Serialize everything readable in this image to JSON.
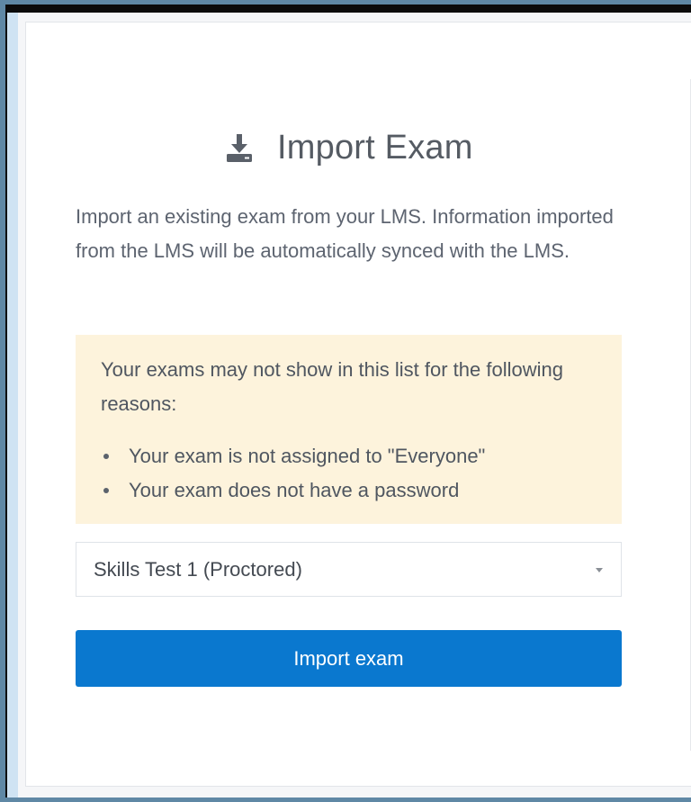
{
  "header": {
    "title": "Import Exam",
    "icon": "download-icon"
  },
  "intro": {
    "text": "Import an existing exam from your LMS. Information imported from the LMS will be automatically synced with the LMS."
  },
  "notice": {
    "lead": "Your exams may not show in this list for the following reasons:",
    "reasons": [
      "Your exam is not assigned to \"Everyone\"",
      "Your exam does not have a password"
    ]
  },
  "exam_select": {
    "selected": "Skills Test 1 (Proctored)"
  },
  "actions": {
    "import_label": "Import exam"
  },
  "colors": {
    "primary": "#0a78cf",
    "notice_bg": "#fdf3dc",
    "text": "#5d6470"
  }
}
